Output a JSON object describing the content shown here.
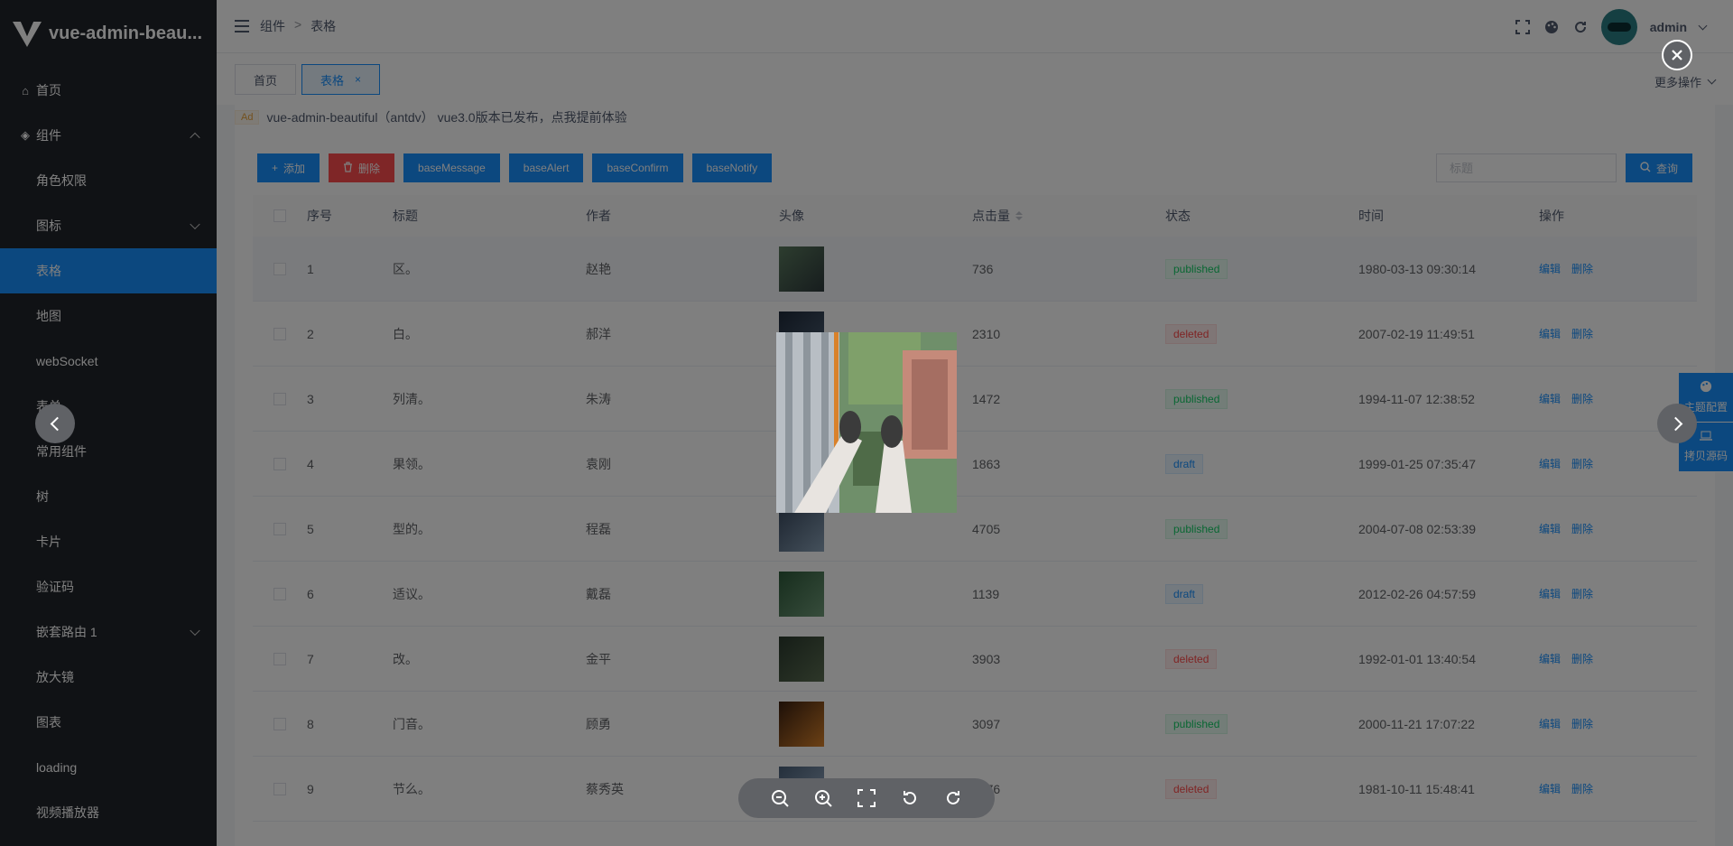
{
  "app": {
    "title": "vue-admin-beau..."
  },
  "sidebar": {
    "items": [
      {
        "label": "首页",
        "icon": "home-icon",
        "level": 1
      },
      {
        "label": "组件",
        "icon": "cube-icon",
        "level": 1,
        "expanded": true
      },
      {
        "label": "角色权限",
        "level": 2
      },
      {
        "label": "图标",
        "level": 2,
        "has_children": true
      },
      {
        "label": "表格",
        "level": 2,
        "active": true
      },
      {
        "label": "地图",
        "level": 2
      },
      {
        "label": "webSocket",
        "level": 2
      },
      {
        "label": "表单",
        "level": 2
      },
      {
        "label": "常用组件",
        "level": 2
      },
      {
        "label": "树",
        "level": 2
      },
      {
        "label": "卡片",
        "level": 2
      },
      {
        "label": "验证码",
        "level": 2
      },
      {
        "label": "嵌套路由 1",
        "level": 2,
        "has_children": true
      },
      {
        "label": "放大镜",
        "level": 2
      },
      {
        "label": "图表",
        "level": 2
      },
      {
        "label": "loading",
        "level": 2
      },
      {
        "label": "视频播放器",
        "level": 2
      }
    ]
  },
  "header": {
    "breadcrumb": [
      "组件",
      "表格"
    ],
    "breadcrumb_sep": ">",
    "username": "admin"
  },
  "tabs": [
    {
      "label": "首页"
    },
    {
      "label": "表格",
      "active": true,
      "close": "×"
    }
  ],
  "more_ops": "更多操作",
  "ad": {
    "badge": "Ad",
    "text": "vue-admin-beautiful（antdv） vue3.0版本已发布，点我提前体验"
  },
  "toolbar": {
    "add": "添加",
    "delete": "删除",
    "base_message": "baseMessage",
    "base_alert": "baseAlert",
    "base_confirm": "baseConfirm",
    "base_notify": "baseNotify"
  },
  "search": {
    "placeholder": "标题",
    "button": "查询"
  },
  "table": {
    "columns": {
      "index": "序号",
      "title": "标题",
      "author": "作者",
      "avatar": "头像",
      "clicks": "点击量",
      "status": "状态",
      "time": "时间",
      "ops": "操作"
    },
    "rows": [
      {
        "index": "1",
        "title": "区。",
        "author": "赵艳",
        "clicks": "736",
        "status": "published",
        "time": "1980-03-13 09:30:14",
        "edit": "编辑",
        "delete": "删除"
      },
      {
        "index": "2",
        "title": "白。",
        "author": "郝洋",
        "clicks": "2310",
        "status": "deleted",
        "time": "2007-02-19 11:49:51",
        "edit": "编辑",
        "delete": "删除"
      },
      {
        "index": "3",
        "title": "列清。",
        "author": "朱涛",
        "clicks": "1472",
        "status": "published",
        "time": "1994-11-07 12:38:52",
        "edit": "编辑",
        "delete": "删除"
      },
      {
        "index": "4",
        "title": "果领。",
        "author": "袁刚",
        "clicks": "1863",
        "status": "draft",
        "time": "1999-01-25 07:35:47",
        "edit": "编辑",
        "delete": "删除"
      },
      {
        "index": "5",
        "title": "型的。",
        "author": "程磊",
        "clicks": "4705",
        "status": "published",
        "time": "2004-07-08 02:53:39",
        "edit": "编辑",
        "delete": "删除"
      },
      {
        "index": "6",
        "title": "适议。",
        "author": "戴磊",
        "clicks": "1139",
        "status": "draft",
        "time": "2012-02-26 04:57:59",
        "edit": "编辑",
        "delete": "删除"
      },
      {
        "index": "7",
        "title": "改。",
        "author": "金平",
        "clicks": "3903",
        "status": "deleted",
        "time": "1992-01-01 13:40:54",
        "edit": "编辑",
        "delete": "删除"
      },
      {
        "index": "8",
        "title": "门音。",
        "author": "顾勇",
        "clicks": "3097",
        "status": "published",
        "time": "2000-11-21 17:07:22",
        "edit": "编辑",
        "delete": "删除"
      },
      {
        "index": "9",
        "title": "节么。",
        "author": "蔡秀英",
        "clicks": "2776",
        "status": "deleted",
        "time": "1981-10-11 15:48:41",
        "edit": "编辑",
        "delete": "删除"
      }
    ]
  },
  "side_buttons": {
    "theme": "主题配置",
    "copy_source": "拷贝源码"
  },
  "colors": {
    "primary": "#1890ff",
    "danger": "#ff4d4f",
    "sidebar_bg": "#21252b"
  }
}
